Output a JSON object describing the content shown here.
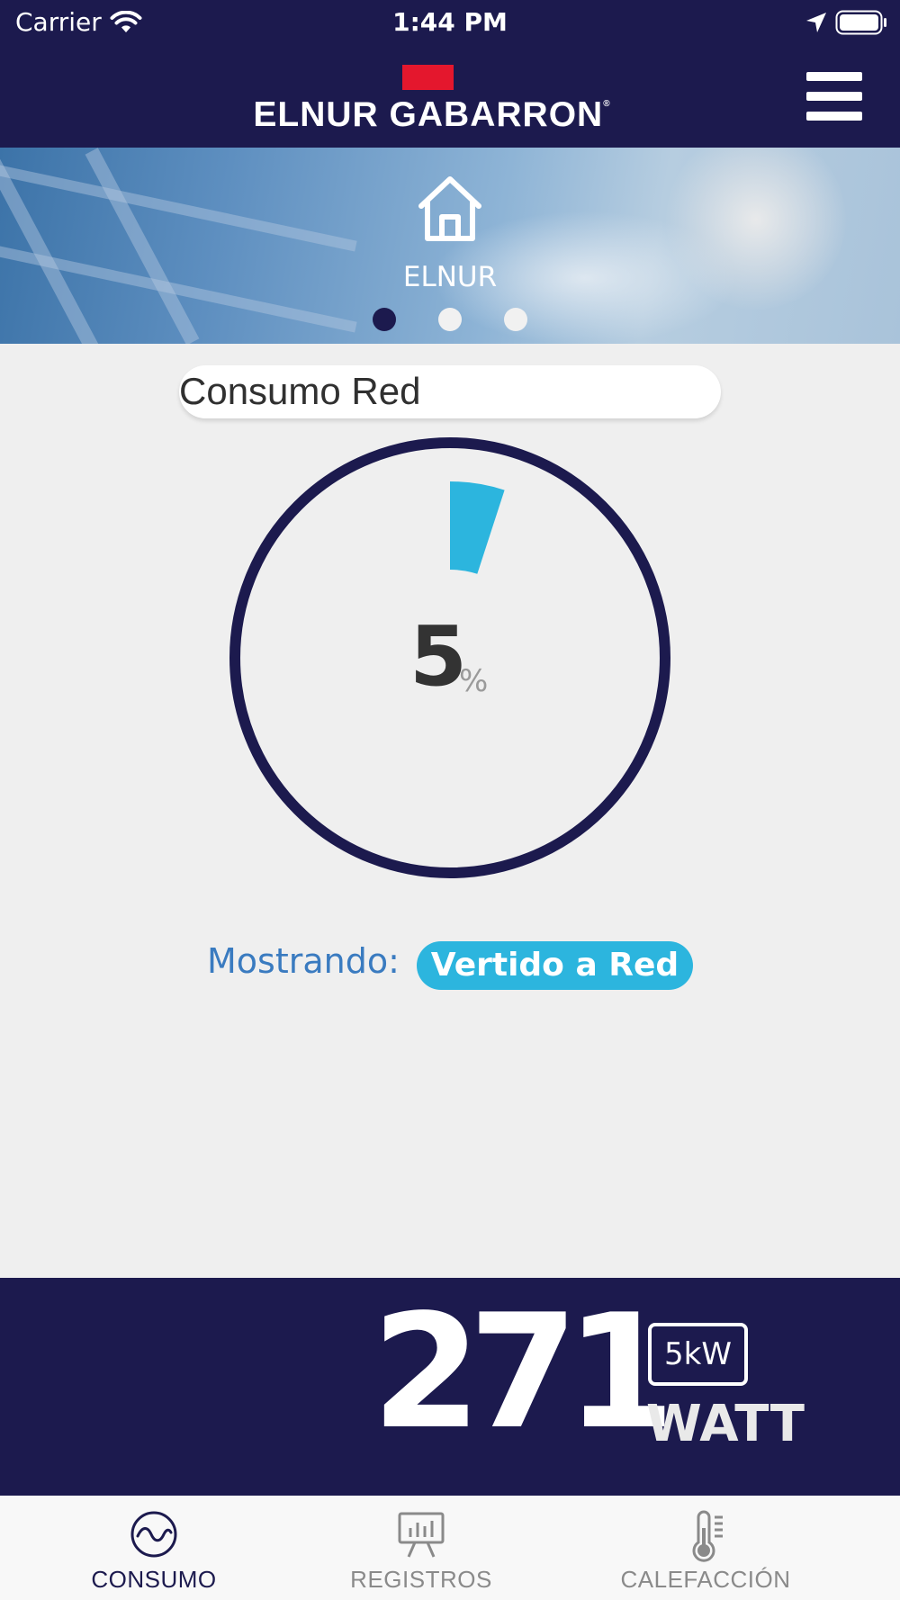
{
  "status_bar": {
    "carrier": "Carrier",
    "time": "1:44 PM",
    "icons": [
      "wifi-icon",
      "location-arrow-icon",
      "battery-icon"
    ]
  },
  "header": {
    "brand": "ELNUR GABARRON",
    "brand_mark": "®",
    "accent_color": "#e4172d",
    "background_color": "#1c1a4e",
    "menu_icon": "hamburger-menu-icon"
  },
  "banner": {
    "icon": "home-icon",
    "installation_name": "ELNUR",
    "page_count": 3,
    "active_page": 1
  },
  "main": {
    "title": "Consumo Red",
    "gauge": {
      "value": "5",
      "unit": "%",
      "fraction": 0.05,
      "arc_color": "#2cb5de",
      "ring_color": "#1c1a4e"
    },
    "showing_label": "Mostrando:",
    "showing_value": "Vertido a Red"
  },
  "power": {
    "value": "271",
    "scale": "5kW",
    "unit": "WATT"
  },
  "tabbar": {
    "tabs": [
      {
        "label": "CONSUMO",
        "icon": "wave-circle-icon",
        "active": true
      },
      {
        "label": "REGISTROS",
        "icon": "chart-board-icon",
        "active": false
      },
      {
        "label": "CALEFACCIÓN",
        "icon": "thermometer-icon",
        "active": false
      }
    ]
  }
}
